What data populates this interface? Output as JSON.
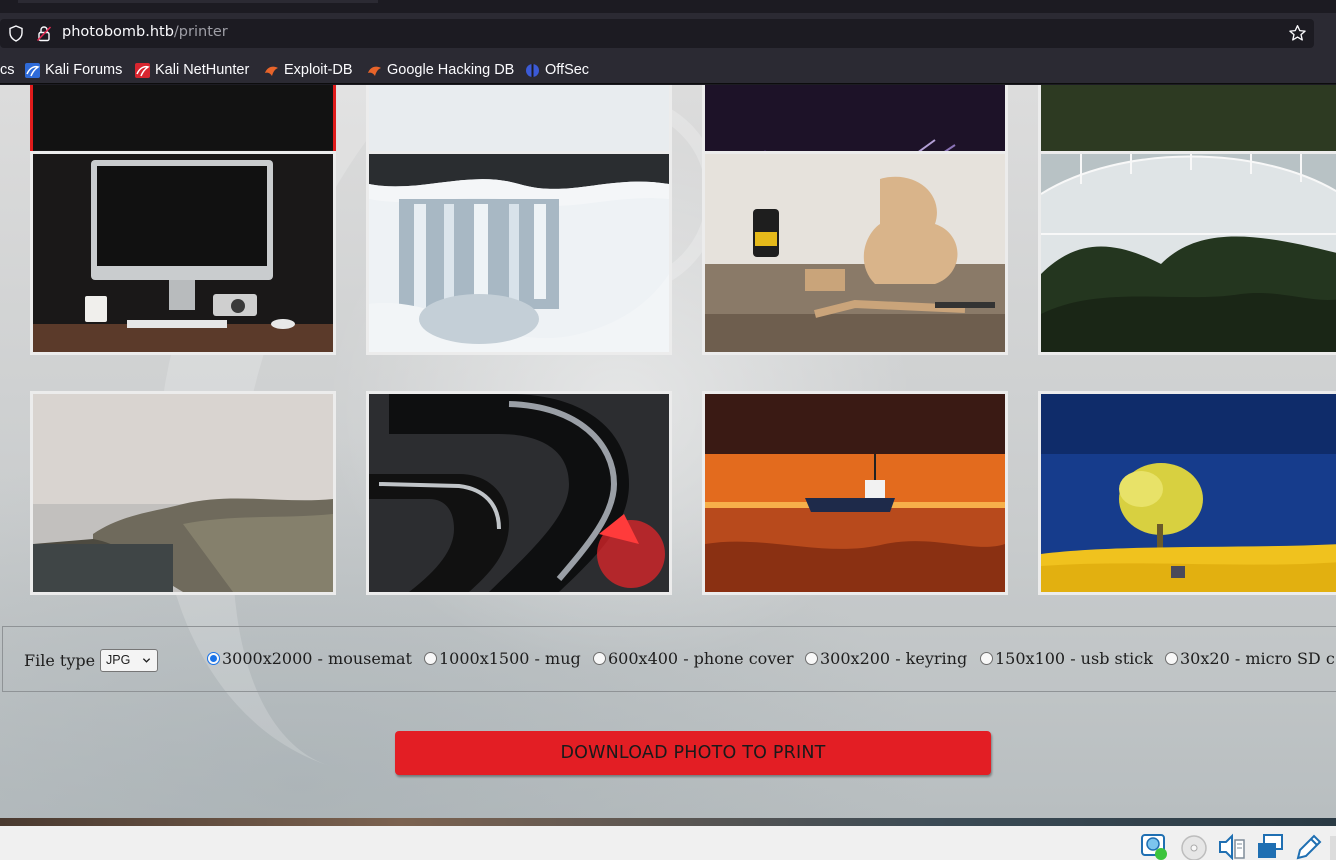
{
  "browser": {
    "url_host": "photobomb.htb",
    "url_path": "/printer",
    "bookmarks": [
      {
        "label": "cs",
        "icon": "none"
      },
      {
        "label": "Kali Forums",
        "icon": "kali-dragon-icon"
      },
      {
        "label": "Kali NetHunter",
        "icon": "nethunter-icon"
      },
      {
        "label": "Exploit-DB",
        "icon": "exploitdb-icon"
      },
      {
        "label": "Google Hacking DB",
        "icon": "ghdb-icon"
      },
      {
        "label": "OffSec",
        "icon": "offsec-icon"
      }
    ]
  },
  "gallery": {
    "selected_index": 0,
    "photos": [
      {
        "subject": "dark photo (cropped)"
      },
      {
        "subject": "blossom branches (cropped)"
      },
      {
        "subject": "purple city lights (cropped)"
      },
      {
        "subject": "green succulent leaves (cropped)"
      },
      {
        "subject": "desktop computer on desk"
      },
      {
        "subject": "frozen waterfall"
      },
      {
        "subject": "woodworking tools and guitar body"
      },
      {
        "subject": "glass greenhouse with plants"
      },
      {
        "subject": "misty coastline"
      },
      {
        "subject": "black and red abstract curves"
      },
      {
        "subject": "boat at sunset on beach"
      },
      {
        "subject": "yellow tree under blue sky"
      }
    ]
  },
  "form": {
    "file_type_label": "File type",
    "file_type_value": "JPG",
    "sizes": [
      {
        "label": "3000x2000 - mousemat",
        "checked": true
      },
      {
        "label": "1000x1500 - mug",
        "checked": false
      },
      {
        "label": "600x400 - phone cover",
        "checked": false
      },
      {
        "label": "300x200 - keyring",
        "checked": false
      },
      {
        "label": "150x100 - usb stick",
        "checked": false
      },
      {
        "label": "30x20 - micro SD c",
        "checked": false
      }
    ],
    "download_label": "DOWNLOAD PHOTO TO PRINT"
  },
  "colors": {
    "accent_red": "#e31e24",
    "selected_border": "#e01b1b",
    "radio_blue": "#1a73e8"
  }
}
